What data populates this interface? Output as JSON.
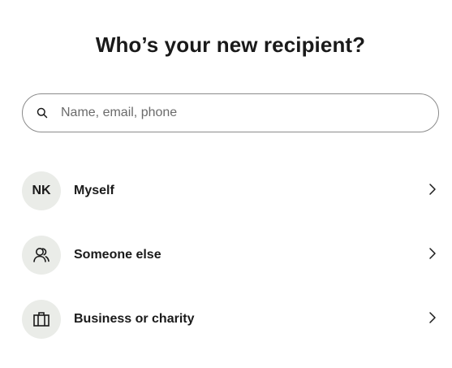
{
  "header": {
    "title": "Who’s your new recipient?"
  },
  "search": {
    "placeholder": "Name, email, phone",
    "value": "",
    "icon": "search-icon"
  },
  "options": [
    {
      "label": "Myself",
      "avatar_text": "NK",
      "icon": "chevron-right-icon"
    },
    {
      "label": "Someone else",
      "icon": "people-icon"
    },
    {
      "label": "Business or charity",
      "icon": "briefcase-icon"
    }
  ],
  "colors": {
    "text": "#1a1a1a",
    "avatar_bg": "#eaece8",
    "border": "#8b8b8b",
    "placeholder": "#6b6b6b"
  }
}
